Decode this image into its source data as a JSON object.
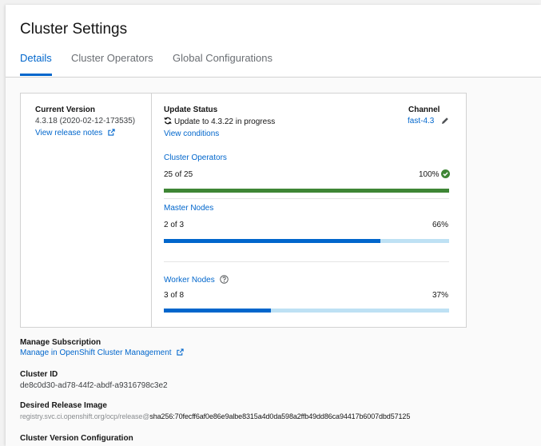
{
  "page": {
    "title": "Cluster Settings"
  },
  "tabs": [
    {
      "label": "Details",
      "active": true
    },
    {
      "label": "Cluster Operators",
      "active": false
    },
    {
      "label": "Global Configurations",
      "active": false
    }
  ],
  "current_version": {
    "heading": "Current Version",
    "value": "4.3.18 (2020-02-12-173535)",
    "release_notes_link": "View release notes"
  },
  "update_status": {
    "heading": "Update Status",
    "status_text": "Update to 4.3.22 in progress",
    "view_conditions_link": "View conditions"
  },
  "channel": {
    "heading": "Channel",
    "value": "fast-4.3"
  },
  "progress": [
    {
      "label": "Cluster Operators",
      "count": "25 of 25",
      "percent_text": "100%",
      "fraction": 1.0,
      "color": "#3e8635",
      "complete": true
    },
    {
      "label": "Master Nodes",
      "count": "2 of 3",
      "percent_text": "66%",
      "fraction": 0.76,
      "color": "#0066cc",
      "complete": false
    },
    {
      "label": "Worker Nodes",
      "count": "3 of 8",
      "percent_text": "37%",
      "fraction": 0.375,
      "color": "#0066cc",
      "complete": false
    }
  ],
  "subscription": {
    "heading": "Manage Subscription",
    "link": "Manage in OpenShift Cluster Management"
  },
  "cluster_id": {
    "heading": "Cluster ID",
    "value": "de8c0d30-ad78-44f2-abdf-a9316798c3e2"
  },
  "release_image": {
    "heading": "Desired Release Image",
    "registry": "registry.svc.ci.openshift.org/ocp/release@",
    "digest": "sha256:70fecff6af0e86e9albe8315a4d0da598a2ffb49dd86ca94417b6007dbd57125"
  },
  "version_config": {
    "heading": "Cluster Version Configuration"
  },
  "colors": {
    "accent": "#0066cc",
    "success": "#3e8635",
    "track": "#bee1f4"
  },
  "icons": {
    "external": "external-link-icon",
    "sync": "sync-icon",
    "edit": "pencil-icon",
    "check": "check-circle-icon",
    "help": "help-icon"
  }
}
